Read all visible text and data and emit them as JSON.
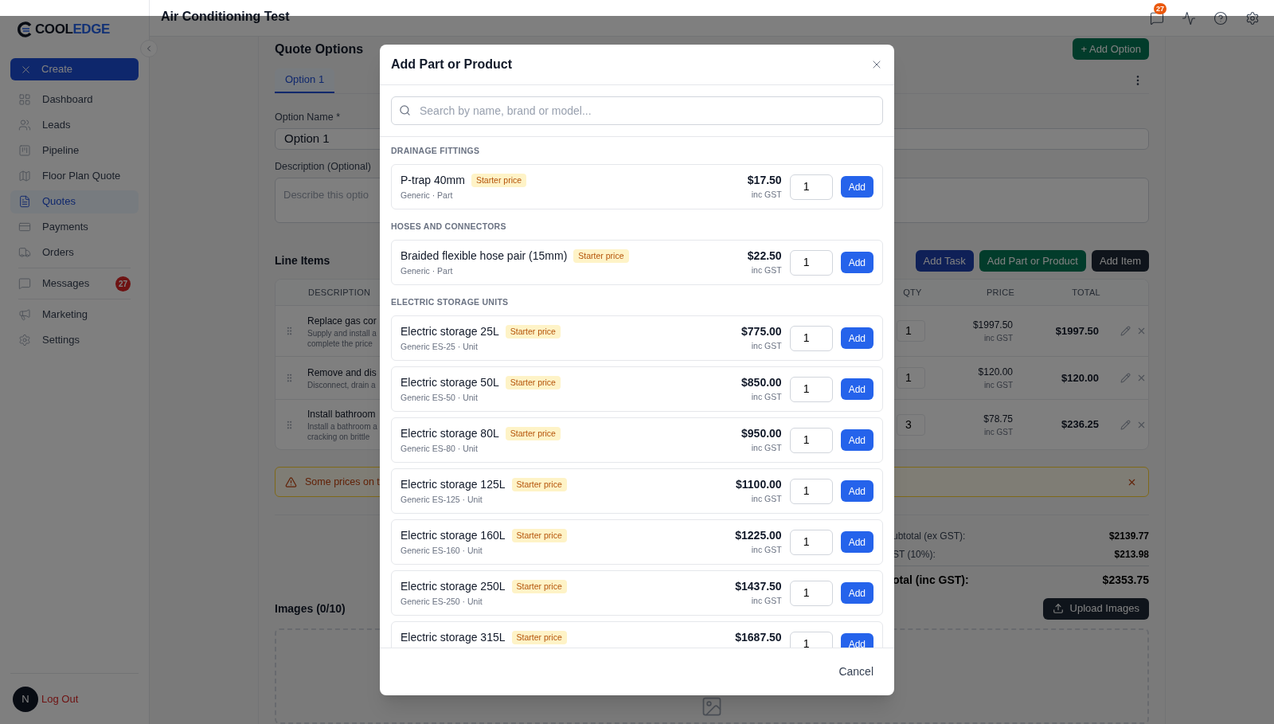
{
  "logo": {
    "dark": "COOL",
    "accent": "EDGE"
  },
  "sidebar": {
    "create": "Create",
    "sections": [
      [
        {
          "label": "Dashboard",
          "selected": false
        },
        {
          "label": "Leads",
          "selected": false
        },
        {
          "label": "Pipeline",
          "selected": false
        },
        {
          "label": "Floor Plan Quote",
          "selected": false
        },
        {
          "label": "Quotes",
          "selected": true
        },
        {
          "label": "Payments",
          "selected": false
        },
        {
          "label": "Orders",
          "selected": false
        }
      ],
      [
        {
          "label": "Messages",
          "selected": false,
          "badge": "27"
        }
      ],
      [
        {
          "label": "Marketing",
          "selected": false
        },
        {
          "label": "Settings",
          "selected": false
        }
      ]
    ],
    "avatar": "N",
    "logout": "Log Out"
  },
  "header": {
    "title": "Air Conditioning Test",
    "messages_badge": "27"
  },
  "quote_options": {
    "title": "Quote Options",
    "add_option": "+ Add Option",
    "tabs": [
      {
        "label": "Option 1",
        "selected": true
      }
    ],
    "name_label": "Option Name",
    "required_mark": "*",
    "name_value": "Option 1",
    "description_label": "Description (Optional)",
    "description_placeholder": "Describe this optio"
  },
  "line_items": {
    "title": "Line Items",
    "buttons": [
      {
        "label": "Add Task",
        "kind": "blue"
      },
      {
        "label": "Add Part or Product",
        "kind": "green"
      },
      {
        "label": "Add Item",
        "kind": "dark"
      }
    ],
    "columns": [
      "DESCRIPTION",
      "QTY",
      "PRICE",
      "TOTAL"
    ],
    "rows": [
      {
        "title": "Replace gas cor",
        "lines": [
          "Supply and install a",
          "complete the price"
        ],
        "qty": "1",
        "price": "$1997.50",
        "tax": "inc GST",
        "total": "$1997.50"
      },
      {
        "title": "Remove and dis",
        "lines": [
          "Disconnect, drain a"
        ],
        "qty": "1",
        "price": "$120.00",
        "tax": "inc GST",
        "total": "$120.00"
      },
      {
        "title": "Install bathroom",
        "lines": [
          "Install a bathroom a",
          "cracking on brittle"
        ],
        "qty": "3",
        "price": "$78.75",
        "tax": "inc GST",
        "total": "$236.25"
      }
    ]
  },
  "alert": {
    "text": "Some prices on t"
  },
  "summary": [
    {
      "label": "ubtotal (ex GST):",
      "value": "$2139.77",
      "kind": "normal"
    },
    {
      "label": "ST (10%):",
      "value": "$213.98",
      "kind": "normal"
    },
    {
      "label": "otal (inc GST):",
      "value": "$2353.75",
      "kind": "total"
    }
  ],
  "images": {
    "title": "Images (0/10)",
    "upload": "Upload Images"
  },
  "modal": {
    "title": "Add Part or Product",
    "search_placeholder": "Search by name, brand or model...",
    "cancel": "Cancel",
    "groups": [
      {
        "heading": "DRAINAGE FITTINGS",
        "items": [
          {
            "name": "P-trap 40mm",
            "badge": "Starter price",
            "subtitle": "Generic · Part",
            "price": "$17.50",
            "tax": "inc GST",
            "qty": "1",
            "add": "Add"
          }
        ]
      },
      {
        "heading": "HOSES AND CONNECTORS",
        "items": [
          {
            "name": "Braided flexible hose pair (15mm)",
            "badge": "Starter price",
            "subtitle": "Generic · Part",
            "price": "$22.50",
            "tax": "inc GST",
            "qty": "1",
            "add": "Add"
          }
        ]
      },
      {
        "heading": "ELECTRIC STORAGE UNITS",
        "items": [
          {
            "name": "Electric storage 25L",
            "badge": "Starter price",
            "subtitle": "Generic ES-25 · Unit",
            "price": "$775.00",
            "tax": "inc GST",
            "qty": "1",
            "add": "Add"
          },
          {
            "name": "Electric storage 50L",
            "badge": "Starter price",
            "subtitle": "Generic ES-50 · Unit",
            "price": "$850.00",
            "tax": "inc GST",
            "qty": "1",
            "add": "Add"
          },
          {
            "name": "Electric storage 80L",
            "badge": "Starter price",
            "subtitle": "Generic ES-80 · Unit",
            "price": "$950.00",
            "tax": "inc GST",
            "qty": "1",
            "add": "Add"
          },
          {
            "name": "Electric storage 125L",
            "badge": "Starter price",
            "subtitle": "Generic ES-125 · Unit",
            "price": "$1100.00",
            "tax": "inc GST",
            "qty": "1",
            "add": "Add"
          },
          {
            "name": "Electric storage 160L",
            "badge": "Starter price",
            "subtitle": "Generic ES-160 · Unit",
            "price": "$1225.00",
            "tax": "inc GST",
            "qty": "1",
            "add": "Add"
          },
          {
            "name": "Electric storage 250L",
            "badge": "Starter price",
            "subtitle": "Generic ES-250 · Unit",
            "price": "$1437.50",
            "tax": "inc GST",
            "qty": "1",
            "add": "Add"
          },
          {
            "name": "Electric storage 315L",
            "badge": "Starter price",
            "price": "$1687.50",
            "qty": "1",
            "add": "Add"
          }
        ]
      }
    ]
  }
}
